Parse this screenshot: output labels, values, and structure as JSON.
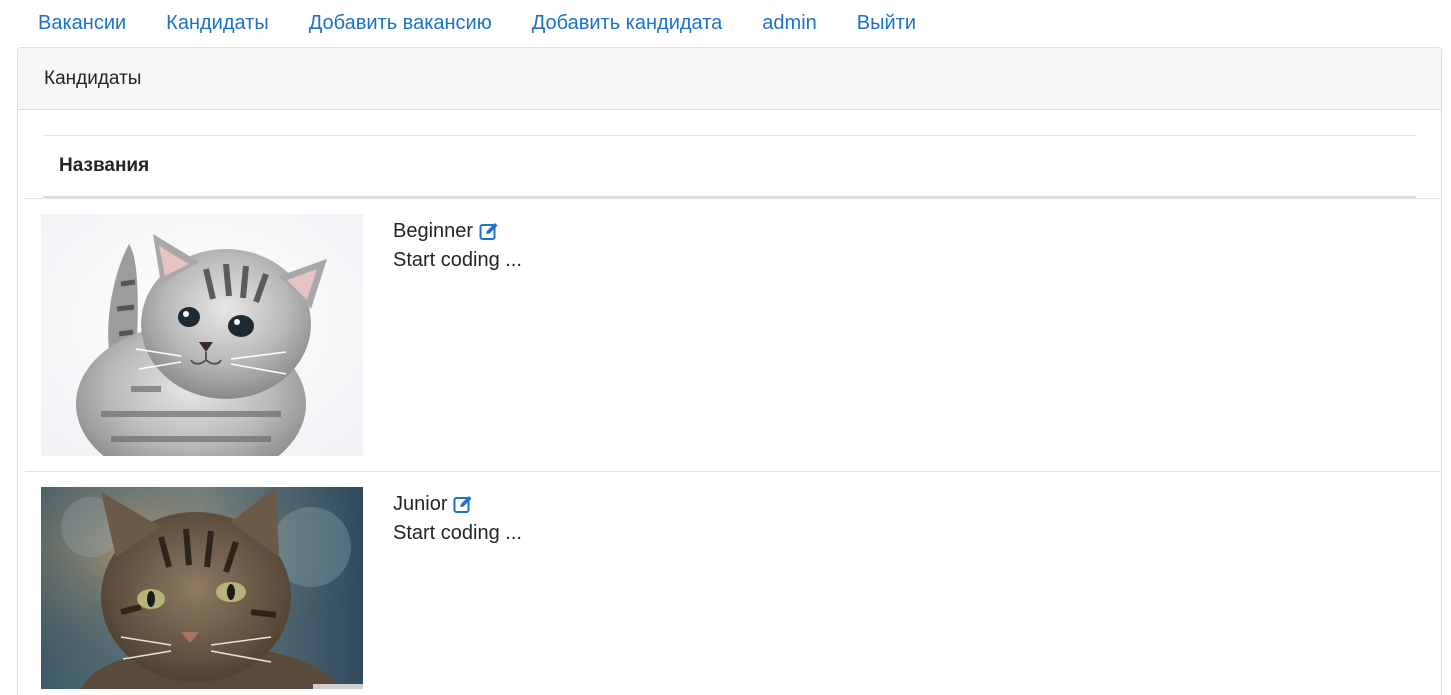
{
  "nav": {
    "vacancies": "Вакансии",
    "candidates": "Кандидаты",
    "add_vacancy": "Добавить вакансию",
    "add_candidate": "Добавить кандидата",
    "user": "admin",
    "logout": "Выйти"
  },
  "card": {
    "header": "Кандидаты",
    "column_header": "Названия"
  },
  "candidates": [
    {
      "name": "Beginner",
      "description": "Start coding ...",
      "photo": "kitten-photo"
    },
    {
      "name": "Junior",
      "description": "Start coding ...",
      "photo": "tabby-cat-photo"
    }
  ],
  "colors": {
    "link": "#1a73c9",
    "header_bg": "#f7f7f7"
  }
}
